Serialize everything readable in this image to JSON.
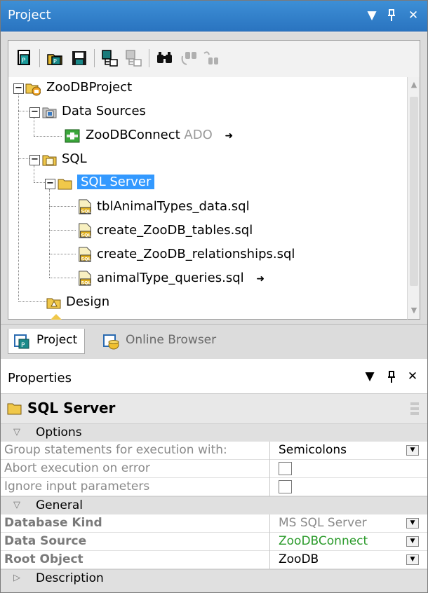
{
  "project_panel": {
    "title": "Project",
    "controls": {
      "dropdown": "▼",
      "pin": "ᵖ",
      "close": "✕"
    }
  },
  "toolbar": {
    "tools": [
      "new-project-icon",
      "open-project-icon",
      "save-project-icon",
      "add-files-icon",
      "add-folder-icon",
      "find-icon",
      "find-next-icon",
      "find-replace-icon"
    ]
  },
  "tree": {
    "root": "ZooDBProject",
    "data_sources": "Data Sources",
    "connection": "ZooDBConnect",
    "connection_type": "ADO",
    "sql_folder": "SQL",
    "sql_server": "SQL Server",
    "files": [
      "tblAnimalTypes_data.sql",
      "create_ZooDB_tables.sql",
      "create_ZooDB_relationships.sql",
      "animalType_queries.sql"
    ],
    "design": "Design"
  },
  "tabs": [
    {
      "label": "Project",
      "active": true
    },
    {
      "label": "Online Browser",
      "active": false
    }
  ],
  "properties": {
    "title": "Properties",
    "object_name": "SQL Server",
    "categories": {
      "options": "Options",
      "general": "General",
      "description": "Description"
    },
    "options_rows": [
      {
        "name": "Group statements for execution with:",
        "value": "Semicolons"
      },
      {
        "name": "Abort execution on error",
        "value": ""
      },
      {
        "name": "Ignore input parameters",
        "value": ""
      }
    ],
    "general_rows": [
      {
        "name": "Database Kind",
        "value": "MS SQL Server"
      },
      {
        "name": "Data Source",
        "value": "ZooDBConnect"
      },
      {
        "name": "Root Object",
        "value": "ZooDB"
      }
    ]
  },
  "colors": {
    "title_blue": "#2f7fcf",
    "selection": "#3399ff",
    "data_source_green": "#2a9a2a"
  }
}
